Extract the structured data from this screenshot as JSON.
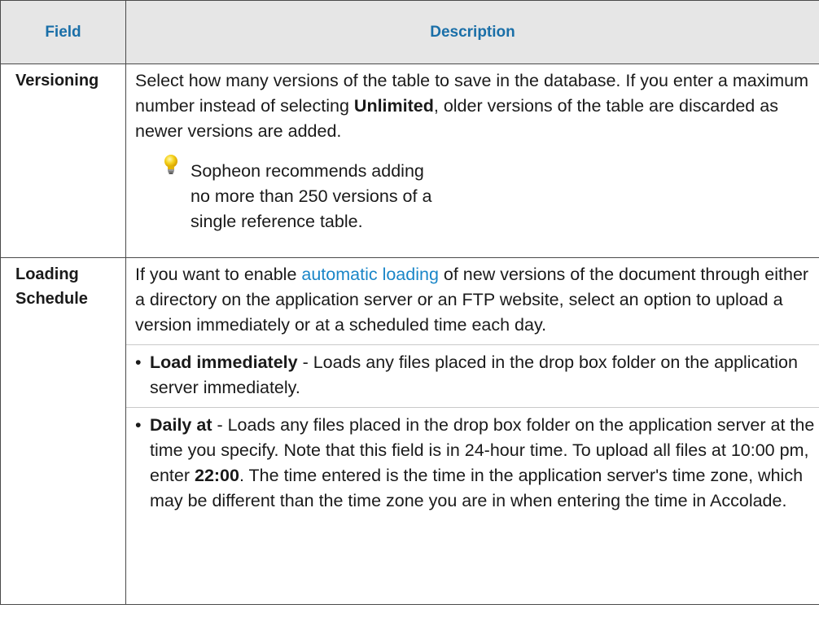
{
  "header": {
    "field": "Field",
    "description": "Description"
  },
  "rows": [
    {
      "field": "Versioning",
      "desc_before": "Select how many versions of the table to save in the database. If you enter a maximum number instead of selecting ",
      "desc_bold": "Unlimited",
      "desc_after": ", older versions of the table are discarded as newer versions are added.",
      "tip": "Sopheon recommends adding no more than 250 versions of a single reference table.",
      "tip_icon": "lightbulb-icon"
    },
    {
      "field_line1": "Loading",
      "field_line2": "Schedule",
      "desc_before": "If you want to enable ",
      "desc_link": "automatic loading",
      "desc_after": " of new versions of the document through either a directory on the application server or an FTP website, select an option to upload a version immediately or at a scheduled time each day.",
      "options": [
        {
          "bullet": "•",
          "label": "Load immediately",
          "text": " - Loads any files placed in the drop box folder on the application server immediately."
        },
        {
          "bullet": "•",
          "label": "Daily at",
          "text_before": " - Loads any files placed in the drop box folder on the application server at the time you specify. Note that this field is in 24-hour time. To upload all files at 10:00 pm, enter ",
          "time_bold": "22:00",
          "text_after": ". The time entered is the time in the application server's time zone, which may be different than the time zone you are in when entering the time in Accolade."
        }
      ]
    }
  ],
  "colors": {
    "header_bg": "#e6e6e6",
    "header_text": "#1a6fa8",
    "link": "#1a86c8",
    "border": "#4a4a4a"
  }
}
